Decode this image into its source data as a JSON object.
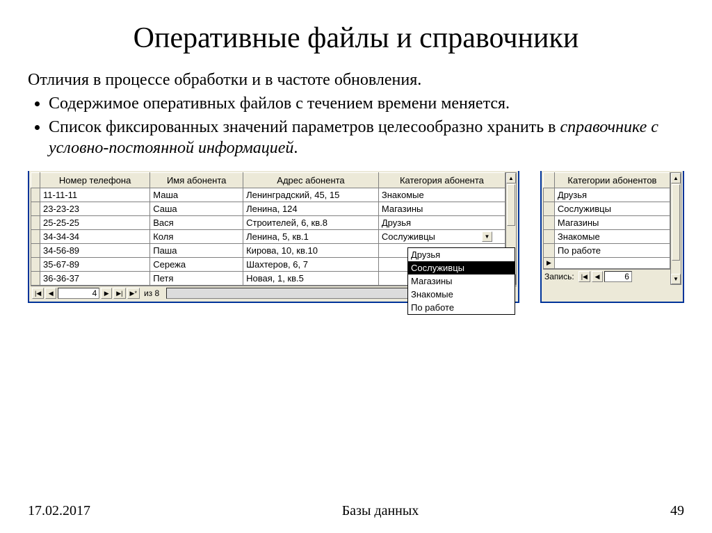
{
  "title": "Оперативные файлы и справочники",
  "intro": "Отличия в процессе обработки и в частоте обновления.",
  "bullet1": "Содержимое оперативных файлов с течением времени меняется.",
  "bullet2a": "Список фиксированных значений параметров целесообразно хранить в ",
  "bullet2b": "справочнике с условно-постоянной информацией",
  "bullet2c": ".",
  "left_table": {
    "headers": [
      "Номер телефона",
      "Имя абонента",
      "Адрес абонента",
      "Категория абонента"
    ],
    "rows": [
      [
        "11-11-11",
        "Маша",
        "Ленинградский, 45, 15",
        "Знакомые"
      ],
      [
        "23-23-23",
        "Саша",
        "Ленина, 124",
        "Магазины"
      ],
      [
        "25-25-25",
        "Вася",
        "Строителей, 6, кв.8",
        "Друзья"
      ],
      [
        "34-34-34",
        "Коля",
        "Ленина, 5, кв.1",
        "Сослуживцы"
      ],
      [
        "34-56-89",
        "Паша",
        "Кирова, 10, кв.10",
        ""
      ],
      [
        "35-67-89",
        "Сережа",
        "Шахтеров, 6, 7",
        ""
      ],
      [
        "36-36-37",
        "Петя",
        "Новая, 1, кв.5",
        ""
      ]
    ],
    "record_pos": "4",
    "record_total": "из 8"
  },
  "dropdown": {
    "options": [
      "Друзья",
      "Сослуживцы",
      "Магазины",
      "Знакомые",
      "По работе"
    ],
    "selected_index": 1
  },
  "right_table": {
    "header": "Категории абонентов",
    "label": "Запись:",
    "rows": [
      "Друзья",
      "Сослуживцы",
      "Магазины",
      "Знакомые",
      "По работе"
    ],
    "record_pos": "6"
  },
  "footer": {
    "date": "17.02.2017",
    "title": "Базы данных",
    "page": "49"
  }
}
